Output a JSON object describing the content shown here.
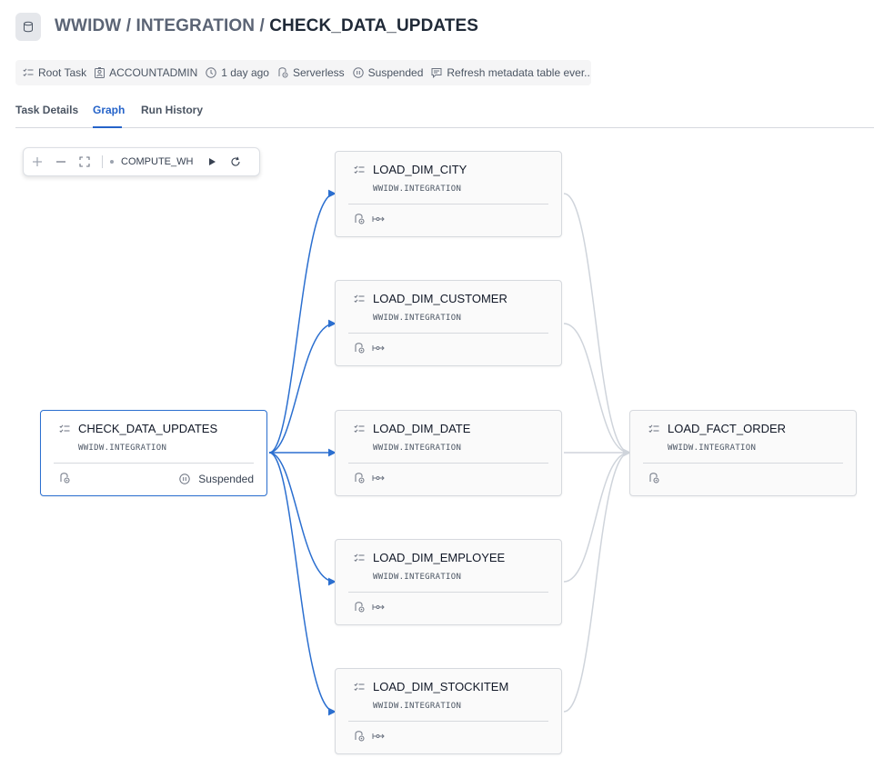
{
  "breadcrumb": {
    "database": "WWIDW",
    "sep1": "/",
    "schema": "INTEGRATION",
    "sep2": "/",
    "task": "CHECK_DATA_UPDATES"
  },
  "meta": {
    "type": "Root Task",
    "owner": "ACCOUNTADMIN",
    "age": "1 day ago",
    "compute": "Serverless",
    "state": "Suspended",
    "comment": "Refresh metadata table ever..."
  },
  "tabs": [
    {
      "label": "Task Details",
      "active": false
    },
    {
      "label": "Graph",
      "active": true
    },
    {
      "label": "Run History",
      "active": false
    }
  ],
  "toolbar": {
    "warehouse": "COMPUTE_WH"
  },
  "graph": {
    "root": {
      "name": "CHECK_DATA_UPDATES",
      "schema": "WWIDW.INTEGRATION",
      "status": "Suspended"
    },
    "children": [
      {
        "name": "LOAD_DIM_CITY",
        "schema": "WWIDW.INTEGRATION"
      },
      {
        "name": "LOAD_DIM_CUSTOMER",
        "schema": "WWIDW.INTEGRATION"
      },
      {
        "name": "LOAD_DIM_DATE",
        "schema": "WWIDW.INTEGRATION"
      },
      {
        "name": "LOAD_DIM_EMPLOYEE",
        "schema": "WWIDW.INTEGRATION"
      },
      {
        "name": "LOAD_DIM_STOCKITEM",
        "schema": "WWIDW.INTEGRATION"
      }
    ],
    "final": {
      "name": "LOAD_FACT_ORDER",
      "schema": "WWIDW.INTEGRATION"
    }
  },
  "colors": {
    "accent": "#2563c9",
    "active_edge": "#2b6fd0",
    "inactive_edge": "#cfd4db"
  },
  "icons": [
    "database-icon",
    "task-list-icon",
    "owner-badge-icon",
    "clock-icon",
    "serverless-icon",
    "pause-icon",
    "comment-icon",
    "zoom-in-icon",
    "zoom-out-icon",
    "fit-view-icon",
    "run-icon",
    "refresh-icon",
    "predecessor-link-icon"
  ]
}
